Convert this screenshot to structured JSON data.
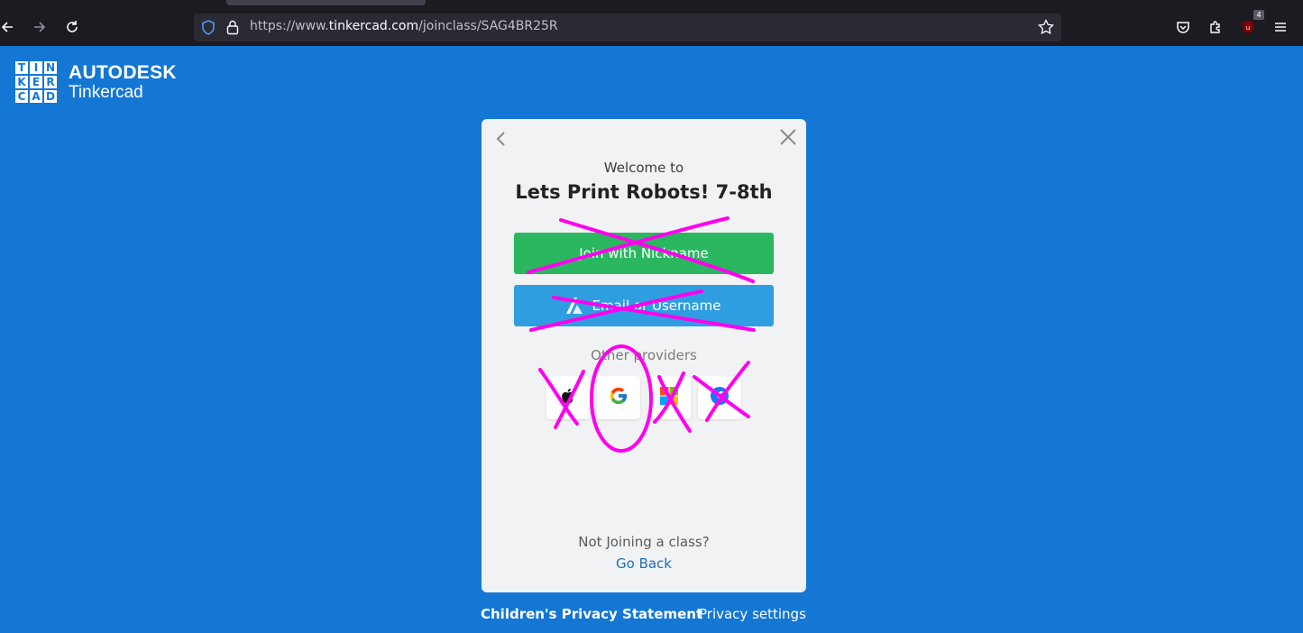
{
  "browser": {
    "url_prefix": "https://www.",
    "url_host": "tinkercad.com",
    "url_path": "/joinclass/SAG4BR25R",
    "extension_badge": "4",
    "icons": [
      "back-icon",
      "forward-icon",
      "reload-icon",
      "shield-icon",
      "lock-icon",
      "star-icon",
      "pocket-icon",
      "extensions-icon",
      "ublock-icon",
      "menu-icon"
    ]
  },
  "logo": {
    "grid_letters": [
      "T",
      "I",
      "N",
      "K",
      "E",
      "R",
      "C",
      "A",
      "D"
    ],
    "brand_top": "AUTODESK",
    "brand_bottom": "Tinkercad"
  },
  "modal": {
    "welcome": "Welcome to",
    "class_name": "Lets Print Robots! 7-8th",
    "nickname_button": "Join with Nickname",
    "email_button": "Email or Username",
    "other_providers": "Other providers",
    "providers": [
      "apple-icon",
      "google-icon",
      "microsoft-icon",
      "facebook-icon"
    ],
    "not_joining": "Not Joining a class?",
    "go_back": "Go Back"
  },
  "footer": {
    "privacy_statement": "Children's Privacy Statement",
    "privacy_settings": "Privacy settings"
  },
  "colors": {
    "page_bg": "#1477d4",
    "nickname_green": "#2bb75f",
    "email_blue": "#2f9ee0",
    "annotation_magenta": "#ff00ee"
  }
}
